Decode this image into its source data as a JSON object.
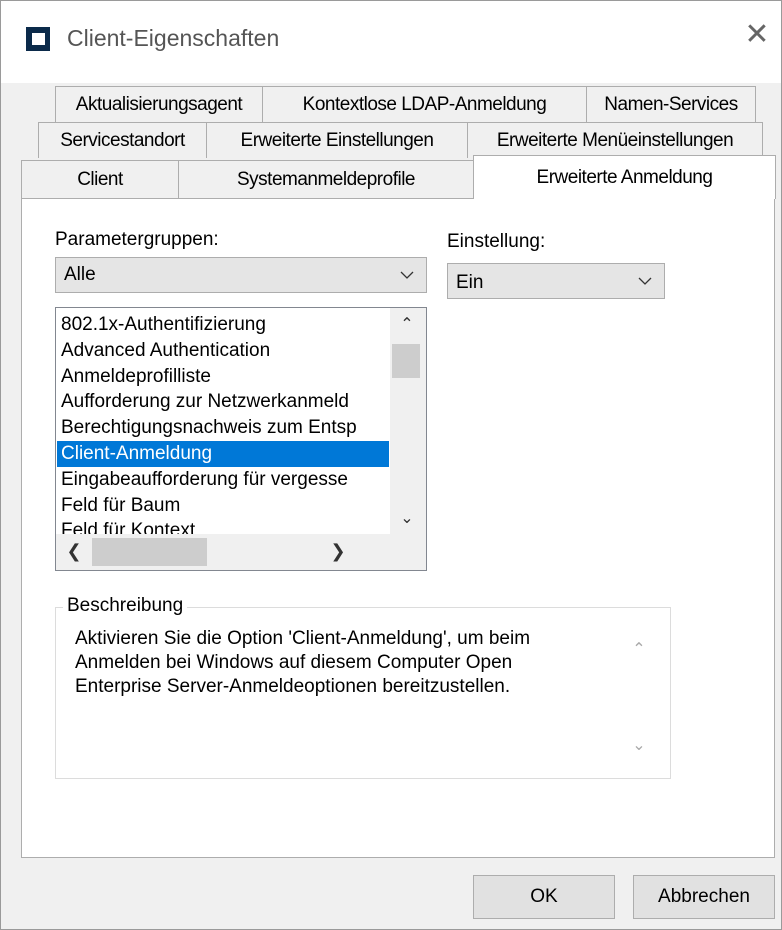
{
  "window": {
    "title": "Client-Eigenschaften",
    "close_glyph": "✕"
  },
  "tabs": {
    "row1": [
      "Aktualisierungsagent",
      "Kontextlose LDAP-Anmeldung",
      "Namen-Services"
    ],
    "row2": [
      "Servicestandort",
      "Erweiterte Einstellungen",
      "Erweiterte Menüeinstellungen"
    ],
    "row3": [
      "Client",
      "Systemanmeldeprofile",
      "Erweiterte Anmeldung"
    ],
    "active": "Erweiterte Anmeldung"
  },
  "parameter_groups": {
    "label": "Parametergruppen:",
    "value": "Alle"
  },
  "setting": {
    "label": "Einstellung:",
    "value": "Ein"
  },
  "parameter_list": {
    "items": [
      "802.1x-Authentifizierung",
      "Advanced Authentication",
      "Anmeldeprofilliste",
      "Aufforderung zur Netzwerkanmeld",
      "Berechtigungsnachweis zum Entsp",
      "Client-Anmeldung",
      "Eingabeaufforderung für vergesse",
      "Feld für Baum",
      "Feld für Kontext"
    ],
    "selected_index": 5
  },
  "description": {
    "legend": "Beschreibung",
    "text": "Aktivieren Sie die Option 'Client-Anmeldung', um beim\nAnmelden bei Windows auf diesem Computer Open\nEnterprise Server-Anmeldeoptionen bereitzustellen."
  },
  "buttons": {
    "ok": "OK",
    "cancel": "Abbrechen"
  },
  "colors": {
    "selection": "#0078d7",
    "title_icon": "#0b2a4a"
  },
  "glyphs": {
    "up": "⌃",
    "down": "⌄",
    "left": "❮",
    "right": "❯"
  }
}
